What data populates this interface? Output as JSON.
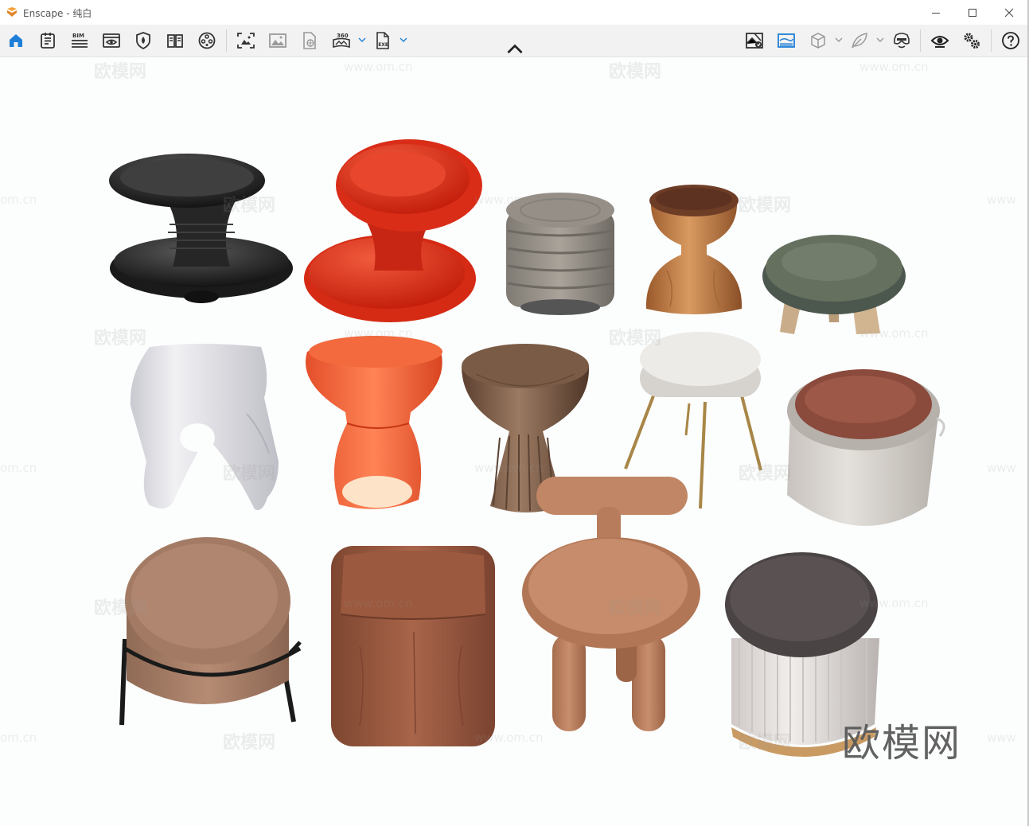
{
  "window": {
    "app_name": "Enscape",
    "separator": " - ",
    "scene_name": "纯白",
    "minimize_icon": "minimize-icon",
    "maximize_icon": "maximize-icon",
    "close_icon": "close-icon"
  },
  "toolbar": {
    "bim_label": "BIM",
    "pano_label": "360",
    "exe_label": "EXE",
    "left_tools": [
      {
        "name": "home",
        "icon": "home-icon",
        "active": true
      },
      {
        "name": "asset-library",
        "icon": "notes-icon"
      },
      {
        "name": "bim-info",
        "icon": "bim-icon"
      },
      {
        "name": "view-management",
        "icon": "eye-window-icon"
      },
      {
        "name": "material-editor",
        "icon": "shield-drop-icon"
      },
      {
        "name": "book",
        "icon": "book-icon"
      },
      {
        "name": "video-editor",
        "icon": "film-reel-icon"
      },
      {
        "name": "screenshot",
        "icon": "screenshot-icon"
      },
      {
        "name": "batch-render",
        "icon": "image-icon"
      },
      {
        "name": "web-export",
        "icon": "file-globe-icon"
      },
      {
        "name": "panorama",
        "icon": "panorama-360-icon"
      },
      {
        "name": "export-exe",
        "icon": "exe-file-icon"
      }
    ],
    "right_tools": [
      {
        "name": "sync-views",
        "icon": "map-sync-icon"
      },
      {
        "name": "capture-view",
        "icon": "sky-image-icon",
        "active": true
      },
      {
        "name": "cube-view",
        "icon": "cube-icon"
      },
      {
        "name": "render-style",
        "icon": "leaf-icon"
      },
      {
        "name": "vr-headset",
        "icon": "vr-headset-icon"
      },
      {
        "name": "visual-settings",
        "icon": "eye-icon"
      },
      {
        "name": "general-settings",
        "icon": "gears-icon"
      },
      {
        "name": "help",
        "icon": "help-icon"
      }
    ],
    "collapse_icon": "chevron-up-icon"
  },
  "watermark": {
    "brand": "欧模网",
    "url": "www.om.cn",
    "url_fragment": "om.cn",
    "url_prefix": "www"
  },
  "colors": {
    "toolbar_bg": "#f2f2f2",
    "viewport_bg": "#fcfdfd",
    "accent_blue": "#1e7fd8"
  },
  "stools": [
    "black-spinning-stool",
    "red-spinning-stool",
    "grey-ribbed-ottoman",
    "wood-hourglass-stool",
    "green-upholstered-footstool",
    "white-sculpted-stool",
    "orange-translucent-stool",
    "walnut-pedestal-stool",
    "white-tripod-stool",
    "leather-lid-pouf",
    "tan-round-ottoman-black-frame",
    "brown-leather-cube",
    "tan-t-back-stool",
    "white-fluted-pouf"
  ]
}
